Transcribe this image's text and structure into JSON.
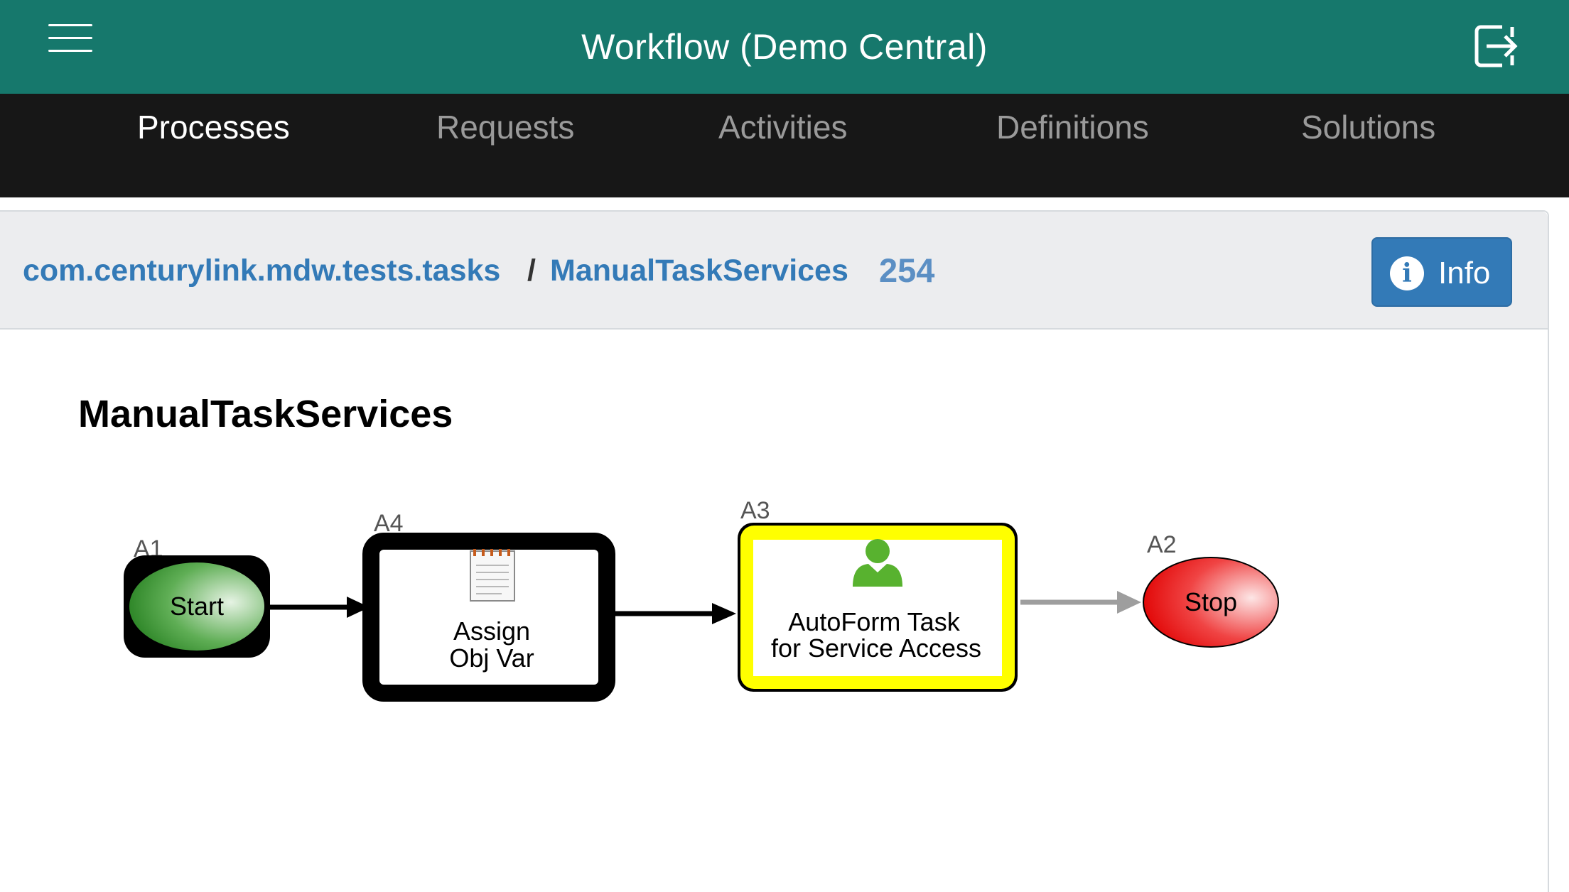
{
  "topbar": {
    "title": "Workflow (Demo Central)",
    "menu_icon": "hamburger-menu-icon",
    "logout_icon": "logout-icon",
    "bg_color": "#16786c"
  },
  "nav": {
    "tabs": [
      {
        "label": "Processes",
        "active": true
      },
      {
        "label": "Requests",
        "active": false
      },
      {
        "label": "Activities",
        "active": false
      },
      {
        "label": "Definitions",
        "active": false
      },
      {
        "label": "Solutions",
        "active": false
      }
    ]
  },
  "breadcrumb": {
    "package": "com.centurylink.mdw.tests.tasks",
    "separator": "/",
    "process": "ManualTaskServices",
    "instance": "254"
  },
  "info_button": {
    "label": "Info",
    "icon": "info-circle-icon",
    "color": "#337ab7"
  },
  "diagram": {
    "title": "ManualTaskServices",
    "nodes": [
      {
        "id": "A1",
        "label": "Start",
        "shape": "ellipse",
        "fill": "green-gradient",
        "icon": ""
      },
      {
        "id": "A4",
        "label_lines": [
          "Assign",
          "Obj Var"
        ],
        "shape": "rectangle",
        "icon": "notepad-icon"
      },
      {
        "id": "A3",
        "label_lines": [
          "AutoForm Task",
          "for Service Access"
        ],
        "shape": "rectangle",
        "highlight": "yellow",
        "icon": "person-icon"
      },
      {
        "id": "A2",
        "label": "Stop",
        "shape": "ellipse",
        "fill": "red-gradient",
        "icon": ""
      }
    ],
    "links": [
      {
        "from": "A1",
        "to": "A4",
        "color": "#000000"
      },
      {
        "from": "A4",
        "to": "A3",
        "color": "#000000"
      },
      {
        "from": "A3",
        "to": "A2",
        "color": "#9e9e9e"
      }
    ]
  }
}
